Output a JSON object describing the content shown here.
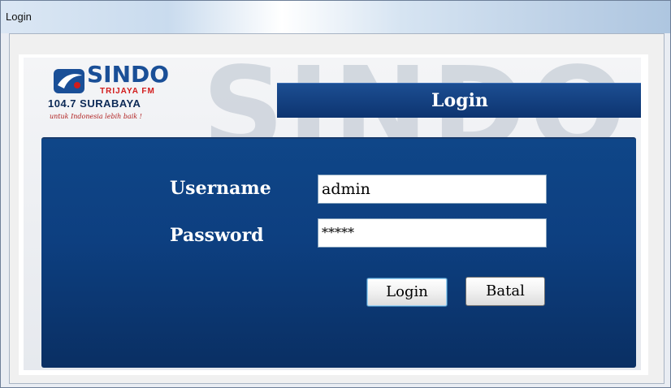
{
  "window": {
    "title": "Login"
  },
  "logo": {
    "name": "SINDO",
    "station": "TRIJAYA FM",
    "frequency": "104.7 SURABAYA",
    "tagline": "untuk Indonesia lebih baik !"
  },
  "watermark": "SINDO",
  "header": {
    "title": "Login"
  },
  "form": {
    "username_label": "Username",
    "username_value": "admin",
    "password_label": "Password",
    "password_value": "*****",
    "login_button": "Login",
    "cancel_button": "Batal"
  },
  "colors": {
    "panel": "#0d3f80",
    "header": "#1c4e92",
    "brand_blue": "#1a4f97",
    "brand_red": "#d21b1b"
  }
}
